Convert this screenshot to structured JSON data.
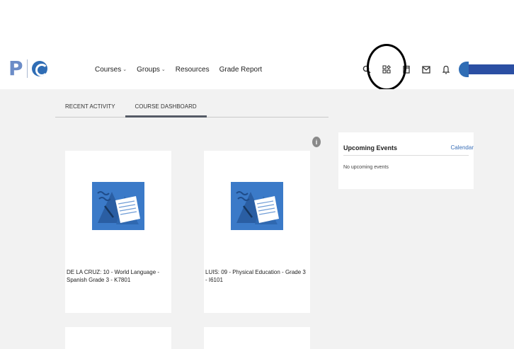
{
  "header": {
    "logo_letter": "P",
    "nav": [
      {
        "label": "Courses",
        "has_menu": true
      },
      {
        "label": "Groups",
        "has_menu": true
      },
      {
        "label": "Resources",
        "has_menu": false
      },
      {
        "label": "Grade Report",
        "has_menu": false
      }
    ],
    "icons": [
      "search-icon",
      "apps-grid-icon",
      "calendar-icon",
      "mail-icon",
      "bell-icon",
      "avatar"
    ]
  },
  "tabs": [
    {
      "label": "RECENT ACTIVITY",
      "active": false
    },
    {
      "label": "COURSE DASHBOARD",
      "active": true
    }
  ],
  "info_glyph": "i",
  "courses": [
    {
      "title": "DE LA CRUZ: 10 - World Language - Spanish Grade 3 - K7801"
    },
    {
      "title": "LUIS: 09 - Physical Education - Grade 3 - I6101"
    }
  ],
  "upcoming_events": {
    "title": "Upcoming Events",
    "calendar_link": "Calendar",
    "empty_text": "No upcoming events"
  },
  "colors": {
    "brand_blue": "#2f6db5",
    "link_blue": "#3a6fb7",
    "page_bg": "#f2f2f2",
    "course_thumb_bg": "#3b7ac8"
  }
}
